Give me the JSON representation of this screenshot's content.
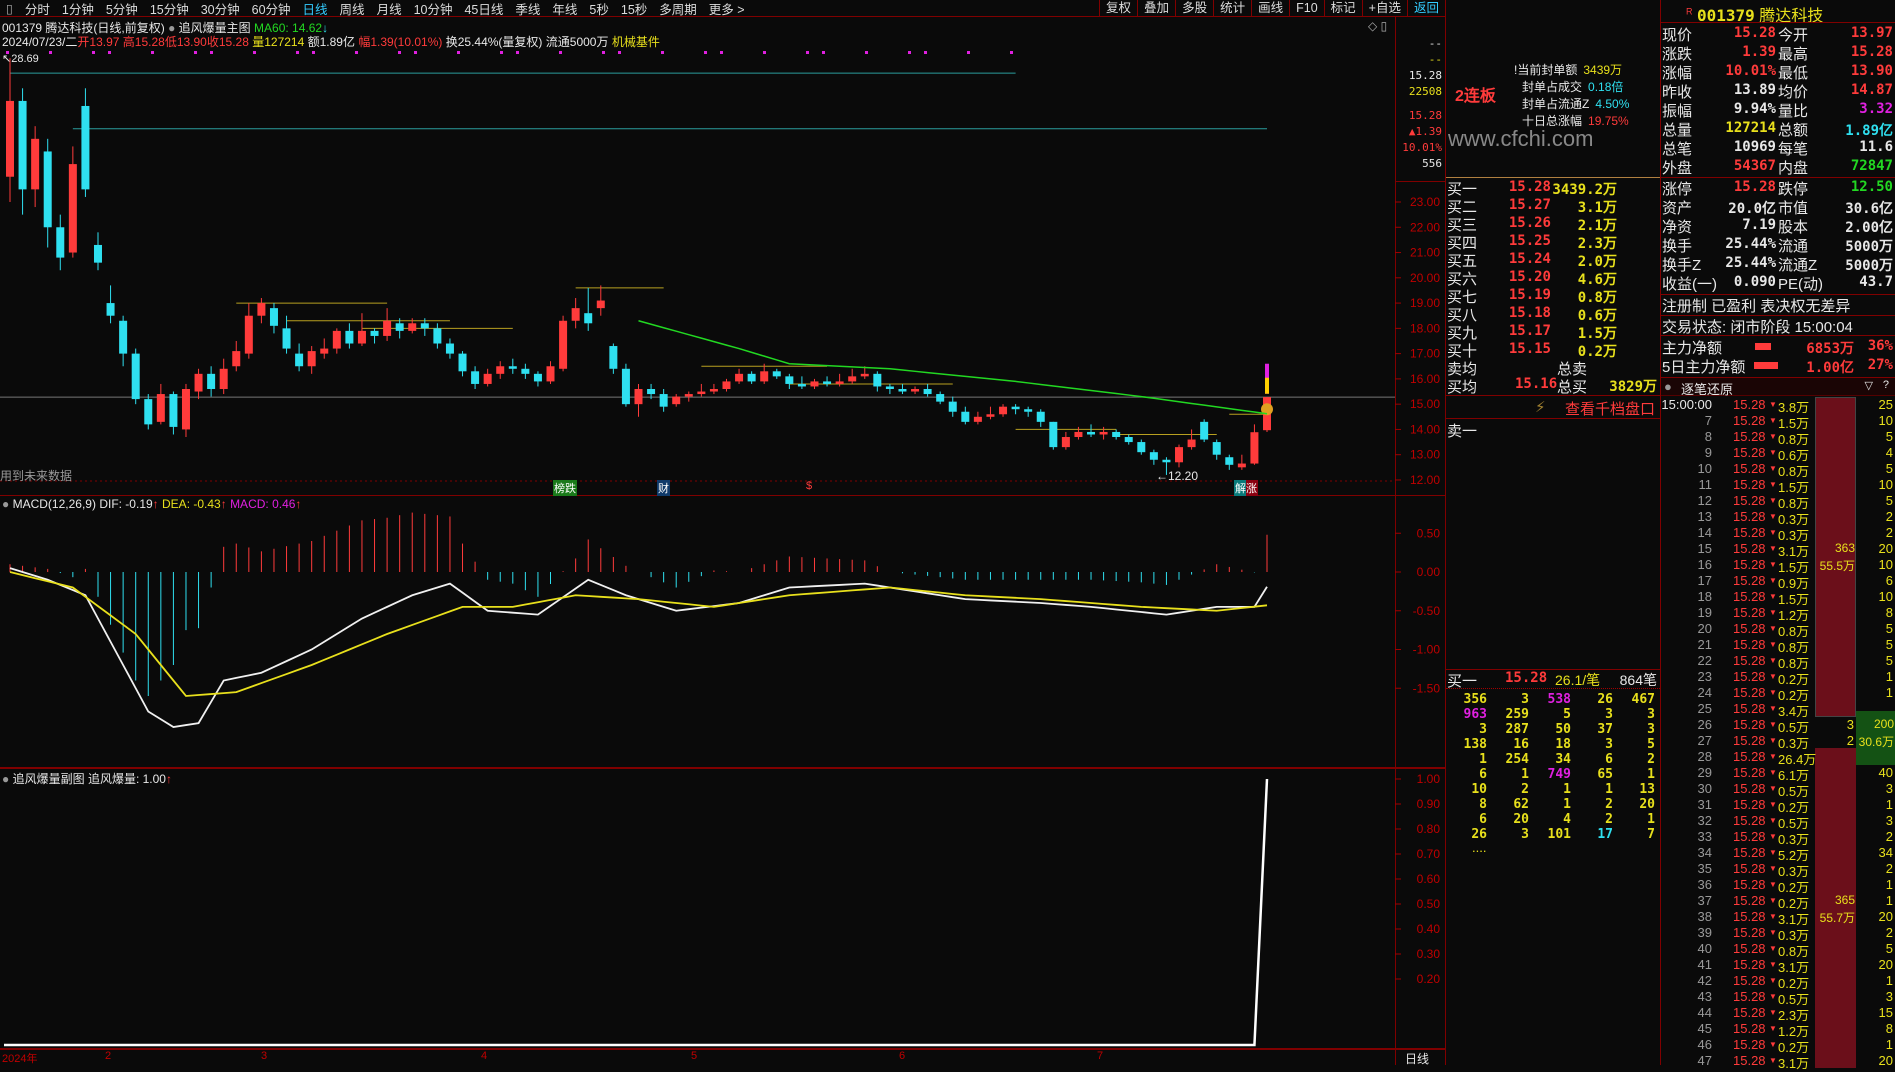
{
  "toolbar": {
    "periods": [
      "分时",
      "1分钟",
      "5分钟",
      "15分钟",
      "30分钟",
      "60分钟",
      "日线",
      "周线",
      "月线",
      "10分钟",
      "45日线",
      "季线",
      "年线",
      "5秒",
      "15秒",
      "多周期",
      "更多 >"
    ],
    "active_period": "日线",
    "actions": [
      "复权",
      "叠加",
      "多股",
      "统计",
      "画线",
      "F10",
      "标记",
      "+自选",
      "返回"
    ]
  },
  "main_header": {
    "title": "001379 腾达科技(日线,前复权)",
    "indicator": "追风爆量主图",
    "ma60": "MA60: 14.62",
    "date": "2024/07/23/二",
    "open": "开13.97",
    "high": "高15.28",
    "low": "低13.90",
    "close": "收15.28",
    "volume": "量127214",
    "amount": "额1.89亿",
    "change": "幅1.39(10.01%)",
    "turnover": "换25.44%(量复权)",
    "float": "流通5000万",
    "sector": "机械基件",
    "max_label": "28.69",
    "min_label": "12.20",
    "future_data_note": "用到未来数据",
    "markers": [
      "榜跌",
      "财",
      "$",
      "解涨"
    ]
  },
  "price_box": {
    "a": "--",
    "b": "--",
    "price": "15.28",
    "vol": "22508",
    "price2": "15.28",
    "chg": "▲1.39",
    "pct": "10.01%",
    "count": "556"
  },
  "macd_header": {
    "title": "MACD(12,26,9)",
    "dif": "DIF: -0.19",
    "dea": "DEA: -0.43",
    "macd": "MACD: 0.46"
  },
  "sub_header": {
    "title": "追风爆量副图",
    "value": "追风爆量: 1.00"
  },
  "x_axis": {
    "labels": [
      "2024年",
      "2",
      "3",
      "4",
      "5",
      "6",
      "7"
    ],
    "period": "日线"
  },
  "chart_data": {
    "type": "candlestick",
    "price_axis": {
      "ticks": [
        "23.00",
        "22.00",
        "21.00",
        "20.00",
        "19.00",
        "18.00",
        "17.00",
        "16.00",
        "15.00",
        "14.00",
        "13.00",
        "12.00"
      ],
      "range": [
        12,
        23
      ]
    },
    "candles": [
      [
        24,
        28.69,
        23,
        27
      ],
      [
        27,
        27.5,
        22.5,
        23.5
      ],
      [
        23.5,
        26,
        22.8,
        25.5
      ],
      [
        25,
        25.5,
        21.2,
        22
      ],
      [
        22,
        22.5,
        20.3,
        20.8
      ],
      [
        21,
        25.2,
        20.8,
        24.5
      ],
      [
        26.8,
        27.5,
        23.2,
        23.5
      ],
      [
        21.3,
        21.8,
        20.3,
        20.6
      ],
      [
        19,
        19.7,
        18.2,
        18.5
      ],
      [
        18.3,
        18.5,
        16.5,
        17
      ],
      [
        17,
        17.2,
        15,
        15.2
      ],
      [
        15.2,
        15.4,
        14,
        14.2
      ],
      [
        14.3,
        15.8,
        14.2,
        15.4
      ],
      [
        15.4,
        15.5,
        13.8,
        14.1
      ],
      [
        14,
        15.8,
        13.7,
        15.6
      ],
      [
        15.5,
        16.4,
        15.2,
        16.2
      ],
      [
        16.2,
        16.5,
        15.3,
        15.6
      ],
      [
        15.6,
        16.8,
        15.4,
        16.4
      ],
      [
        16.5,
        17.5,
        16.3,
        17.1
      ],
      [
        17,
        19,
        16.8,
        18.5
      ],
      [
        18.5,
        19.2,
        18.2,
        19
      ],
      [
        18.8,
        19,
        17.8,
        18.1
      ],
      [
        18,
        18.5,
        17,
        17.2
      ],
      [
        17,
        17.4,
        16.3,
        16.5
      ],
      [
        16.5,
        17.3,
        16.2,
        17.1
      ],
      [
        17,
        17.6,
        16.8,
        17.2
      ],
      [
        17.2,
        18,
        17,
        17.9
      ],
      [
        17.9,
        18.2,
        17.2,
        17.4
      ],
      [
        17.4,
        18.6,
        17.3,
        17.9
      ],
      [
        17.9,
        18,
        17.4,
        17.7
      ],
      [
        17.7,
        18.8,
        17.5,
        18.3
      ],
      [
        18.2,
        18.4,
        17.6,
        17.9
      ],
      [
        17.9,
        18.4,
        17.8,
        18.2
      ],
      [
        18.2,
        18.4,
        17.7,
        18
      ],
      [
        18,
        18.2,
        17.2,
        17.4
      ],
      [
        17.4,
        17.6,
        16.8,
        17
      ],
      [
        17,
        17.1,
        16.1,
        16.3
      ],
      [
        16.3,
        16.5,
        15.6,
        15.8
      ],
      [
        15.8,
        16.4,
        15.7,
        16.2
      ],
      [
        16.2,
        16.7,
        16,
        16.5
      ],
      [
        16.5,
        16.8,
        16.2,
        16.4
      ],
      [
        16.4,
        16.6,
        16,
        16.2
      ],
      [
        16.2,
        16.3,
        15.7,
        15.9
      ],
      [
        15.9,
        16.7,
        15.8,
        16.5
      ],
      [
        16.4,
        18.5,
        16.3,
        18.3
      ],
      [
        18.3,
        19.2,
        18,
        18.8
      ],
      [
        18.6,
        19.6,
        17.9,
        18.2
      ],
      [
        18.8,
        19.7,
        18.5,
        19.1
      ],
      [
        17.3,
        17.4,
        16.2,
        16.4
      ],
      [
        16.4,
        16.6,
        14.9,
        15
      ],
      [
        15,
        15.8,
        14.5,
        15.6
      ],
      [
        15.6,
        15.8,
        15.2,
        15.4
      ],
      [
        15.4,
        15.6,
        14.7,
        14.9
      ],
      [
        15,
        15.4,
        14.9,
        15.3
      ],
      [
        15.3,
        15.5,
        15.1,
        15.4
      ],
      [
        15.4,
        15.8,
        15.3,
        15.5
      ],
      [
        15.5,
        15.8,
        15.4,
        15.6
      ],
      [
        15.6,
        16,
        15.5,
        15.9
      ],
      [
        15.9,
        16.4,
        15.8,
        16.2
      ],
      [
        16.2,
        16.3,
        15.8,
        15.9
      ],
      [
        15.9,
        16.6,
        15.8,
        16.3
      ],
      [
        16.3,
        16.4,
        16,
        16.1
      ],
      [
        16.1,
        16.2,
        15.6,
        15.8
      ],
      [
        15.8,
        16.1,
        15.6,
        15.7
      ],
      [
        15.7,
        16,
        15.6,
        15.9
      ],
      [
        15.9,
        16.1,
        15.7,
        15.8
      ],
      [
        15.8,
        16.2,
        15.7,
        15.9
      ],
      [
        15.9,
        16.4,
        15.8,
        16.1
      ],
      [
        16.1,
        16.5,
        16,
        16.2
      ],
      [
        16.2,
        16.3,
        15.5,
        15.7
      ],
      [
        15.7,
        15.8,
        15.4,
        15.6
      ],
      [
        15.6,
        15.8,
        15.4,
        15.5
      ],
      [
        15.5,
        15.7,
        15.4,
        15.6
      ],
      [
        15.6,
        15.8,
        15.3,
        15.4
      ],
      [
        15.4,
        15.5,
        15,
        15.1
      ],
      [
        15.1,
        15.3,
        14.5,
        14.7
      ],
      [
        14.7,
        14.9,
        14.2,
        14.3
      ],
      [
        14.3,
        14.7,
        14.2,
        14.5
      ],
      [
        14.5,
        14.9,
        14.4,
        14.6
      ],
      [
        14.6,
        15,
        14.5,
        14.9
      ],
      [
        14.9,
        15,
        14.6,
        14.8
      ],
      [
        14.8,
        14.9,
        14.5,
        14.7
      ],
      [
        14.7,
        14.8,
        14.1,
        14.3
      ],
      [
        14.3,
        14.3,
        13.2,
        13.3
      ],
      [
        13.3,
        13.9,
        13.2,
        13.7
      ],
      [
        13.7,
        14.1,
        13.6,
        13.9
      ],
      [
        13.9,
        14.2,
        13.7,
        13.8
      ],
      [
        13.8,
        14.1,
        13.6,
        13.9
      ],
      [
        13.9,
        14,
        13.6,
        13.7
      ],
      [
        13.7,
        13.8,
        13.4,
        13.5
      ],
      [
        13.5,
        13.6,
        13,
        13.1
      ],
      [
        13.1,
        13.2,
        12.6,
        12.8
      ],
      [
        12.8,
        12.9,
        12.2,
        12.7
      ],
      [
        12.7,
        13.4,
        12.5,
        13.3
      ],
      [
        13.3,
        14,
        13.2,
        13.6
      ],
      [
        14.3,
        14.4,
        13.5,
        13.6
      ],
      [
        13.5,
        13.6,
        12.8,
        13
      ],
      [
        12.9,
        13,
        12.4,
        12.6
      ],
      [
        12.5,
        13,
        12.4,
        12.65
      ],
      [
        12.65,
        14.2,
        12.6,
        13.89
      ],
      [
        13.97,
        15.28,
        13.9,
        15.28
      ]
    ],
    "ma60_keyframes": [
      [
        50,
        18.3
      ],
      [
        58,
        17.2
      ],
      [
        62,
        16.6
      ],
      [
        70,
        16.4
      ],
      [
        80,
        15.9
      ],
      [
        90,
        15.3
      ],
      [
        100,
        14.62
      ]
    ],
    "macd": {
      "axis_ticks": [
        "0.50",
        "0.00",
        "-0.50",
        "-1.00",
        "-1.50"
      ],
      "dif_keyframes": [
        [
          0,
          0.05
        ],
        [
          3,
          -0.1
        ],
        [
          6,
          -0.3
        ],
        [
          9,
          -1.2
        ],
        [
          11,
          -1.8
        ],
        [
          13,
          -2.0
        ],
        [
          15,
          -1.95
        ],
        [
          17,
          -1.4
        ],
        [
          20,
          -1.3
        ],
        [
          24,
          -1.0
        ],
        [
          28,
          -0.6
        ],
        [
          32,
          -0.3
        ],
        [
          35,
          -0.15
        ],
        [
          38,
          -0.5
        ],
        [
          42,
          -0.55
        ],
        [
          46,
          -0.1
        ],
        [
          49,
          -0.3
        ],
        [
          53,
          -0.5
        ],
        [
          58,
          -0.4
        ],
        [
          62,
          -0.2
        ],
        [
          68,
          -0.15
        ],
        [
          72,
          -0.25
        ],
        [
          76,
          -0.35
        ],
        [
          82,
          -0.4
        ],
        [
          86,
          -0.45
        ],
        [
          92,
          -0.55
        ],
        [
          96,
          -0.45
        ],
        [
          99,
          -0.45
        ],
        [
          100,
          -0.19
        ]
      ],
      "dea_keyframes": [
        [
          0,
          0
        ],
        [
          5,
          -0.2
        ],
        [
          10,
          -0.8
        ],
        [
          14,
          -1.6
        ],
        [
          18,
          -1.55
        ],
        [
          24,
          -1.2
        ],
        [
          30,
          -0.8
        ],
        [
          36,
          -0.45
        ],
        [
          40,
          -0.45
        ],
        [
          45,
          -0.3
        ],
        [
          50,
          -0.35
        ],
        [
          56,
          -0.45
        ],
        [
          62,
          -0.3
        ],
        [
          70,
          -0.2
        ],
        [
          76,
          -0.3
        ],
        [
          82,
          -0.35
        ],
        [
          90,
          -0.45
        ],
        [
          96,
          -0.5
        ],
        [
          100,
          -0.43
        ]
      ]
    },
    "sub": {
      "axis_ticks": [
        "1.00",
        "0.90",
        "0.80",
        "0.70",
        "0.60",
        "0.50",
        "0.40",
        "0.30",
        "0.20"
      ],
      "baseline": 0,
      "spike_index": 100,
      "spike_value": 1.0
    }
  },
  "limit_info": {
    "streak": "2连板",
    "rows": [
      {
        "label": "当前封单额",
        "value": "3439万",
        "color": "y"
      },
      {
        "label": "封单占成交",
        "value": "0.18倍",
        "color": "c"
      },
      {
        "label": "封单占流通Z",
        "value": "4.50%",
        "color": "c"
      },
      {
        "label": "十日总涨幅",
        "value": "19.75%",
        "color": "r"
      }
    ],
    "watermark": "www.cfchi.com"
  },
  "order_book": {
    "bids": [
      [
        "买一",
        "15.28",
        "3439.2万"
      ],
      [
        "买二",
        "15.27",
        "3.1万"
      ],
      [
        "买三",
        "15.26",
        "2.1万"
      ],
      [
        "买四",
        "15.25",
        "2.3万"
      ],
      [
        "买五",
        "15.24",
        "2.0万"
      ],
      [
        "买六",
        "15.20",
        "4.6万"
      ],
      [
        "买七",
        "15.19",
        "0.8万"
      ],
      [
        "买八",
        "15.18",
        "0.6万"
      ],
      [
        "买九",
        "15.17",
        "1.5万"
      ],
      [
        "买十",
        "15.15",
        "0.2万"
      ]
    ],
    "sell_avg_label": "卖均",
    "total_sell_label": "总卖",
    "buy_avg_label": "买均",
    "buy_avg": "15.16",
    "total_buy_label": "总买",
    "total_buy": "3829万",
    "thousand_link": "查看千档盘口",
    "ask1_label": "卖一"
  },
  "queue": {
    "label": "买一",
    "price": "15.28",
    "per": "26.1/笔",
    "count": "864笔",
    "rows": [
      [
        "356",
        "3",
        "538",
        "26",
        "467"
      ],
      [
        "963",
        "259",
        "5",
        "3",
        "3"
      ],
      [
        "3",
        "287",
        "50",
        "37",
        "3"
      ],
      [
        "138",
        "16",
        "18",
        "3",
        "5"
      ],
      [
        "1",
        "254",
        "34",
        "6",
        "2"
      ],
      [
        "6",
        "1",
        "749",
        "65",
        "1"
      ],
      [
        "10",
        "2",
        "1",
        "1",
        "13"
      ],
      [
        "8",
        "62",
        "1",
        "2",
        "20"
      ],
      [
        "6",
        "20",
        "4",
        "2",
        "1"
      ],
      [
        "26",
        "3",
        "101",
        "17",
        "7"
      ]
    ],
    "magenta": [
      "0-2",
      "1-0",
      "5-2"
    ],
    "cyan": [
      "9-3"
    ],
    "more": "...."
  },
  "quote": {
    "code": "001379",
    "name": "腾达科技",
    "flag": "R",
    "rows": [
      [
        "现价",
        "15.28",
        "r",
        "今开",
        "13.97",
        "r"
      ],
      [
        "涨跌",
        "1.39",
        "r",
        "最高",
        "15.28",
        "r"
      ],
      [
        "涨幅",
        "10.01%",
        "r",
        "最低",
        "13.90",
        "r"
      ],
      [
        "昨收",
        "13.89",
        "w",
        "均价",
        "14.87",
        "r"
      ],
      [
        "振幅",
        "9.94%",
        "w",
        "量比",
        "3.32",
        "m"
      ],
      [
        "总量",
        "127214",
        "y",
        "总额",
        "1.89亿",
        "c"
      ],
      [
        "总笔",
        "10969",
        "w",
        "每笔",
        "11.6",
        "w"
      ],
      [
        "外盘",
        "54367",
        "r",
        "内盘",
        "72847",
        "g"
      ]
    ],
    "rows2": [
      [
        "涨停",
        "15.28",
        "r",
        "跌停",
        "12.50",
        "g"
      ],
      [
        "资产",
        "20.0亿",
        "w",
        "市值",
        "30.6亿",
        "w"
      ],
      [
        "净资",
        "7.19",
        "w",
        "股本",
        "2.00亿",
        "w"
      ],
      [
        "换手",
        "25.44%",
        "w",
        "流通",
        "5000万",
        "w"
      ],
      [
        "换手Z",
        "25.44%",
        "w",
        "流通Z",
        "5000万",
        "w"
      ],
      [
        "收益(一)",
        "0.090",
        "w",
        "PE(动)",
        "43.7",
        "w"
      ]
    ],
    "tags": "注册制 已盈利 表决权无差异",
    "status": "交易状态: 闭市阶段 15:00:04",
    "main_net": {
      "label": "主力净额",
      "value": "6853万",
      "pct": "36%"
    },
    "main_net5": {
      "label": "5日主力净额",
      "value": "1.00亿",
      "pct": "27%"
    }
  },
  "ticks": {
    "title": "逐笔还原",
    "rows": [
      [
        "15:00:00",
        "15.28",
        "3.8万",
        "25"
      ],
      [
        "7",
        "15.28",
        "1.5万",
        "10"
      ],
      [
        "8",
        "15.28",
        "0.8万",
        "5"
      ],
      [
        "9",
        "15.28",
        "0.6万",
        "4"
      ],
      [
        "10",
        "15.28",
        "0.8万",
        "5"
      ],
      [
        "11",
        "15.28",
        "1.5万",
        "10"
      ],
      [
        "12",
        "15.28",
        "0.8万",
        "5"
      ],
      [
        "13",
        "15.28",
        "0.3万",
        "2"
      ],
      [
        "14",
        "15.28",
        "0.3万",
        "2"
      ],
      [
        "15",
        "15.28",
        "3.1万",
        "20"
      ],
      [
        "16",
        "15.28",
        "1.5万",
        "10"
      ],
      [
        "17",
        "15.28",
        "0.9万",
        "6"
      ],
      [
        "18",
        "15.28",
        "1.5万",
        "10"
      ],
      [
        "19",
        "15.28",
        "1.2万",
        "8"
      ],
      [
        "20",
        "15.28",
        "0.8万",
        "5"
      ],
      [
        "21",
        "15.28",
        "0.8万",
        "5"
      ],
      [
        "22",
        "15.28",
        "0.8万",
        "5"
      ],
      [
        "23",
        "15.28",
        "0.2万",
        "1"
      ],
      [
        "24",
        "15.28",
        "0.2万",
        "1"
      ],
      [
        "25",
        "15.28",
        "3.4万",
        ""
      ],
      [
        "26",
        "15.28",
        "0.5万",
        "3"
      ],
      [
        "27",
        "15.28",
        "0.3万",
        "2"
      ],
      [
        "28",
        "15.28",
        "26.4万",
        ""
      ],
      [
        "29",
        "15.28",
        "6.1万",
        "40"
      ],
      [
        "30",
        "15.28",
        "0.5万",
        "3"
      ],
      [
        "31",
        "15.28",
        "0.2万",
        "1"
      ],
      [
        "32",
        "15.28",
        "0.5万",
        "3"
      ],
      [
        "33",
        "15.28",
        "0.3万",
        "2"
      ],
      [
        "34",
        "15.28",
        "5.2万",
        "34"
      ],
      [
        "35",
        "15.28",
        "0.3万",
        "2"
      ],
      [
        "36",
        "15.28",
        "0.2万",
        "1"
      ],
      [
        "37",
        "15.28",
        "0.2万",
        "1"
      ],
      [
        "38",
        "15.28",
        "3.1万",
        "20"
      ],
      [
        "39",
        "15.28",
        "0.3万",
        "2"
      ],
      [
        "40",
        "15.28",
        "0.8万",
        "5"
      ],
      [
        "41",
        "15.28",
        "3.1万",
        "20"
      ],
      [
        "42",
        "15.28",
        "0.2万",
        "1"
      ],
      [
        "43",
        "15.28",
        "0.5万",
        "3"
      ],
      [
        "44",
        "15.28",
        "2.3万",
        "15"
      ],
      [
        "45",
        "15.28",
        "1.2万",
        "8"
      ],
      [
        "46",
        "15.28",
        "0.2万",
        "1"
      ],
      [
        "47",
        "15.28",
        "3.1万",
        "20"
      ]
    ],
    "block1": {
      "count": "363",
      "amount": "55.5万"
    },
    "block_green": {
      "count": "200",
      "amount": "30.6万"
    },
    "block2": {
      "count": "365",
      "amount": "55.7万"
    }
  }
}
